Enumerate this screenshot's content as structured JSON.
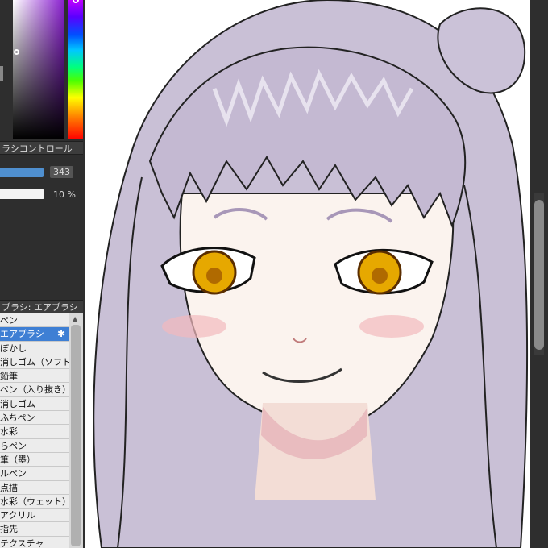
{
  "brush_control": {
    "title": "ラシコントロール",
    "size_value": "343",
    "opacity_value": "10 %"
  },
  "brush_panel": {
    "title": "ブラシ: エアブラシ",
    "items": [
      {
        "label": "ペン",
        "selected": false
      },
      {
        "label": "エアブラシ",
        "selected": true
      },
      {
        "label": "ぼかし",
        "selected": false
      },
      {
        "label": "消しゴム（ソフト）",
        "selected": false
      },
      {
        "label": "鉛筆",
        "selected": false
      },
      {
        "label": "ペン（入り抜き）",
        "selected": false
      },
      {
        "label": "消しゴム",
        "selected": false
      },
      {
        "label": "ふちペン",
        "selected": false
      },
      {
        "label": "水彩",
        "selected": false
      },
      {
        "label": "らペン",
        "selected": false
      },
      {
        "label": "筆（墨）",
        "selected": false
      },
      {
        "label": "ルペン",
        "selected": false
      },
      {
        "label": "点描",
        "selected": false
      },
      {
        "label": "水彩（ウェット）",
        "selected": false
      },
      {
        "label": "アクリル",
        "selected": false
      },
      {
        "label": "指先",
        "selected": false
      },
      {
        "label": "テクスチャ",
        "selected": false
      }
    ]
  },
  "colors": {
    "slider_size": "#4f8fcf",
    "slider_opacity": "#f4f4f4",
    "selected_item": "#3e7fd4",
    "hair": "#c9c0d6",
    "iris": "#e6a800"
  },
  "icons": {
    "settings": "gear-icon",
    "scroll_up": "up-arrow-icon"
  }
}
